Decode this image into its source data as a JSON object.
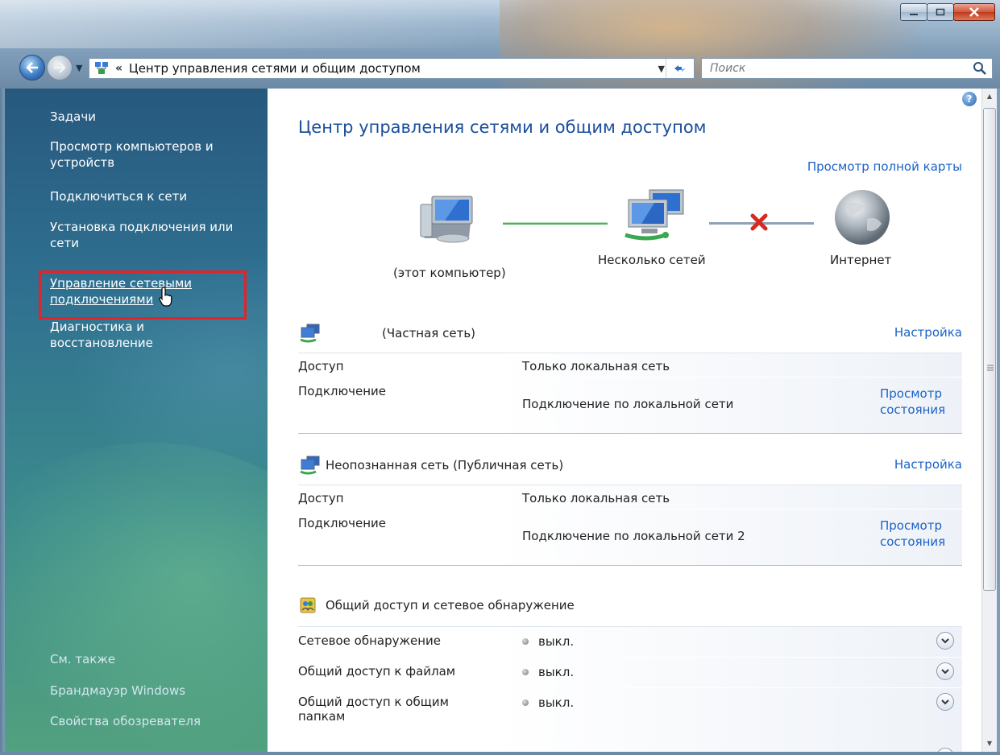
{
  "window": {
    "address_chevron": "«",
    "address_path": "Центр управления сетями и общим доступом",
    "search_placeholder": "Поиск"
  },
  "taskpane": {
    "heading": "Задачи",
    "tasks": [
      {
        "label": "Просмотр компьютеров и устройств"
      },
      {
        "label": "Подключиться к сети"
      },
      {
        "label": "Установка подключения или сети"
      },
      {
        "label": "Управление сетевыми подключениями"
      },
      {
        "label": "Диагностика и восстановление"
      }
    ],
    "see_also_heading": "См. также",
    "see_also": [
      {
        "label": "Брандмауэр Windows"
      },
      {
        "label": "Свойства обозревателя"
      }
    ]
  },
  "main": {
    "title": "Центр управления сетями и общим доступом",
    "full_map_link": "Просмотр полной карты",
    "map": {
      "this_computer": "(этот компьютер)",
      "multiple_networks": "Несколько сетей",
      "internet": "Интернет"
    },
    "networks": [
      {
        "name": "(Частная сеть)",
        "settings_link": "Настройка",
        "rows": [
          {
            "label": "Доступ",
            "value": "Только локальная сеть",
            "link": ""
          },
          {
            "label": "Подключение",
            "value": "Подключение по локальной сети",
            "link": "Просмотр состояния"
          }
        ]
      },
      {
        "name": "Неопознанная сеть (Публичная сеть)",
        "settings_link": "Настройка",
        "rows": [
          {
            "label": "Доступ",
            "value": "Только локальная сеть",
            "link": ""
          },
          {
            "label": "Подключение",
            "value": "Подключение по локальной сети 2",
            "link": "Просмотр состояния"
          }
        ]
      }
    ],
    "sharing": {
      "heading": "Общий доступ и сетевое обнаружение",
      "items": [
        {
          "label": "Сетевое обнаружение",
          "state": "выкл."
        },
        {
          "label": "Общий доступ к файлам",
          "state": "выкл."
        },
        {
          "label": "Общий доступ к общим папкам",
          "state": "выкл."
        }
      ]
    }
  },
  "colors": {
    "link": "#1a62c8",
    "title": "#1a4e9b",
    "highlight": "#e0242a",
    "disconnected": "#d8281f"
  },
  "icons": {
    "help": "help-icon",
    "error": "red-x-icon",
    "expand": "chevron-down-icon"
  }
}
